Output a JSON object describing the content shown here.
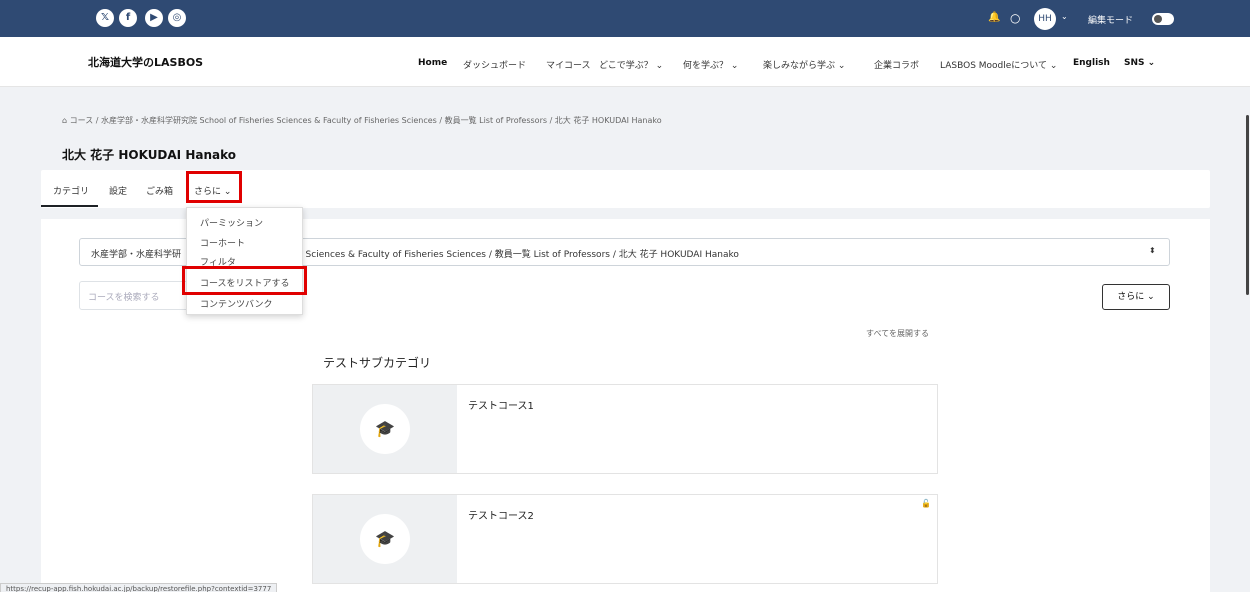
{
  "topbar": {
    "social": [
      {
        "name": "x-icon",
        "glyph": "𝕏"
      },
      {
        "name": "facebook-icon",
        "glyph": "f"
      },
      {
        "name": "youtube-icon",
        "glyph": "▶"
      },
      {
        "name": "instagram-icon",
        "glyph": "◎"
      }
    ],
    "bell_glyph": "🔔",
    "chat_glyph": "○",
    "avatar": "HH",
    "chevron": "⌄",
    "edit_mode_label": "編集モード"
  },
  "navbar": {
    "brand": "北海道大学のLASBOS",
    "items": [
      "Home",
      "ダッシュボード",
      "マイコース",
      "どこで学ぶ？ ⌄",
      "何を学ぶ？ ⌄",
      "楽しみながら学ぶ ⌄",
      "企業コラボ",
      "LASBOS Moodleについて ⌄",
      "English",
      "SNS ⌄"
    ]
  },
  "breadcrumb": "⌂ コース / 水産学部・水産科学研究院 School of Fisheries Sciences & Faculty of Fisheries Sciences / 教員一覧 List of Professors / 北大 花子 HOKUDAI Hanako",
  "page_title": "北大 花子 HOKUDAI Hanako",
  "secondary_nav": {
    "tabs": [
      "カテゴリ",
      "設定",
      "ごみ箱",
      "さらに ⌄"
    ]
  },
  "dropdown": {
    "items": [
      "パーミッション",
      "コーホート",
      "フィルタ",
      "コースをリストアする",
      "コンテンツバンク"
    ]
  },
  "category_select": {
    "left_text": "水産学部・水産科学研",
    "right_text": "s Sciences & Faculty of Fisheries Sciences / 教員一覧 List of Professors / 北大 花子 HOKUDAI Hanako",
    "arrow": "⬍"
  },
  "search": {
    "placeholder": "コースを検索する"
  },
  "more_button": "さらに ⌄",
  "expand_all": "すべてを展開する",
  "subcategory_title": "テストサブカテゴリ",
  "courses": [
    {
      "title": "テストコース1",
      "icon": "graduation-cap-icon"
    },
    {
      "title": "テストコース2",
      "icon": "graduation-cap-icon",
      "lock": "🔓"
    }
  ],
  "status_url": "https://recup-app.fish.hokudai.ac.jp/backup/restorefile.php?contextid=3777",
  "colors": {
    "topbar": "#2f4a73",
    "highlight": "#e00000"
  }
}
